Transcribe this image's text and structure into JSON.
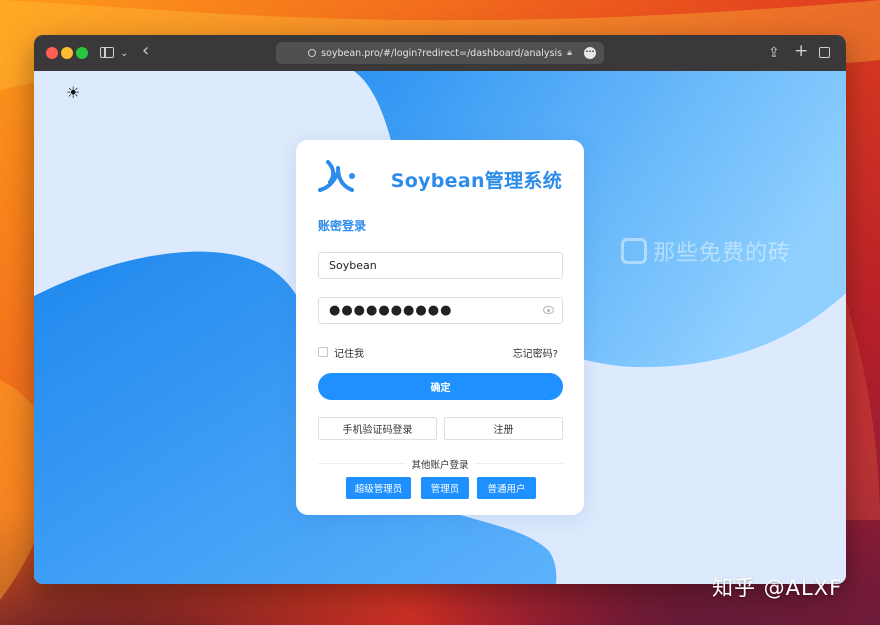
{
  "browser": {
    "url": "soybean.pro/#/login?redirect=/dashboard/analysis"
  },
  "watermark": {
    "text": "那些免费的砖"
  },
  "login": {
    "brand_title": "Soybean管理系统",
    "section_title": "账密登录",
    "username_value": "Soybean",
    "password_masked": "●●●●●●●●●●",
    "remember_label": "记住我",
    "forgot_link": "忘记密码?",
    "confirm_label": "确定",
    "sms_login_label": "手机验证码登录",
    "register_label": "注册",
    "other_accounts_label": "其他账户登录",
    "roles": [
      "超级管理员",
      "管理员",
      "普通用户"
    ]
  },
  "signature": "知乎 @ALXF",
  "colors": {
    "primary": "#1e90ff",
    "brand_text": "#2d8ceb",
    "page_bg": "#dde9fc"
  }
}
